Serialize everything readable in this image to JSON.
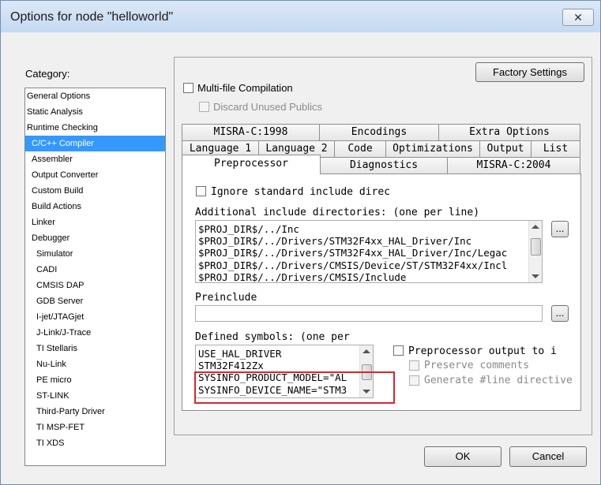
{
  "window": {
    "title": "Options for node \"helloworld\"",
    "close_label": "✕"
  },
  "category": {
    "label": "Category:",
    "items": [
      {
        "label": "General Options",
        "indent": 0
      },
      {
        "label": "Static Analysis",
        "indent": 0
      },
      {
        "label": "Runtime Checking",
        "indent": 0
      },
      {
        "label": "C/C++ Compiler",
        "indent": 1,
        "selected": true
      },
      {
        "label": "Assembler",
        "indent": 1
      },
      {
        "label": "Output Converter",
        "indent": 1
      },
      {
        "label": "Custom Build",
        "indent": 1
      },
      {
        "label": "Build Actions",
        "indent": 1
      },
      {
        "label": "Linker",
        "indent": 1
      },
      {
        "label": "Debugger",
        "indent": 1
      },
      {
        "label": "Simulator",
        "indent": 2
      },
      {
        "label": "CADI",
        "indent": 2
      },
      {
        "label": "CMSIS DAP",
        "indent": 2
      },
      {
        "label": "GDB Server",
        "indent": 2
      },
      {
        "label": "I-jet/JTAGjet",
        "indent": 2
      },
      {
        "label": "J-Link/J-Trace",
        "indent": 2
      },
      {
        "label": "TI Stellaris",
        "indent": 2
      },
      {
        "label": "Nu-Link",
        "indent": 2
      },
      {
        "label": "PE micro",
        "indent": 2
      },
      {
        "label": "ST-LINK",
        "indent": 2
      },
      {
        "label": "Third-Party Driver",
        "indent": 2
      },
      {
        "label": "TI MSP-FET",
        "indent": 2
      },
      {
        "label": "TI XDS",
        "indent": 2
      }
    ]
  },
  "options": {
    "factory_settings": "Factory Settings",
    "multifile": "Multi-file Compilation",
    "discard_unused": "Discard Unused Publics"
  },
  "tabs": {
    "row1": [
      "MISRA-C:1998",
      "Encodings",
      "Extra Options"
    ],
    "row2": [
      "Language 1",
      "Language 2",
      "Code",
      "Optimizations",
      "Output",
      "List"
    ],
    "row3": [
      "Preprocessor",
      "Diagnostics",
      "MISRA-C:2004"
    ]
  },
  "preprocessor": {
    "ignore_std": "Ignore standard include direc",
    "include_label": "Additional include directories: (one per line)",
    "include_dirs": [
      "$PROJ_DIR$/../Inc",
      "$PROJ_DIR$/../Drivers/STM32F4xx_HAL_Driver/Inc",
      "$PROJ_DIR$/../Drivers/STM32F4xx_HAL_Driver/Inc/Legac",
      "$PROJ_DIR$/../Drivers/CMSIS/Device/ST/STM32F4xx/Incl",
      "$PROJ_DIR$/../Drivers/CMSIS/Include"
    ],
    "browse_label": "...",
    "preinclude_label": "Preinclude",
    "preinclude_value": "",
    "defined_label": "Defined symbols: (one per",
    "defined_symbols": [
      "USE_HAL_DRIVER",
      "STM32F412Zx",
      "SYSINFO_PRODUCT_MODEL=\"AL",
      "SYSINFO_DEVICE_NAME=\"STM3"
    ],
    "pp_output": "Preprocessor output to i",
    "preserve_comments": "Preserve comments",
    "gen_line": "Generate #line directive"
  },
  "buttons": {
    "ok": "OK",
    "cancel": "Cancel"
  },
  "colors": {
    "selection": "#3399ff",
    "highlight_box": "#d9262c"
  }
}
